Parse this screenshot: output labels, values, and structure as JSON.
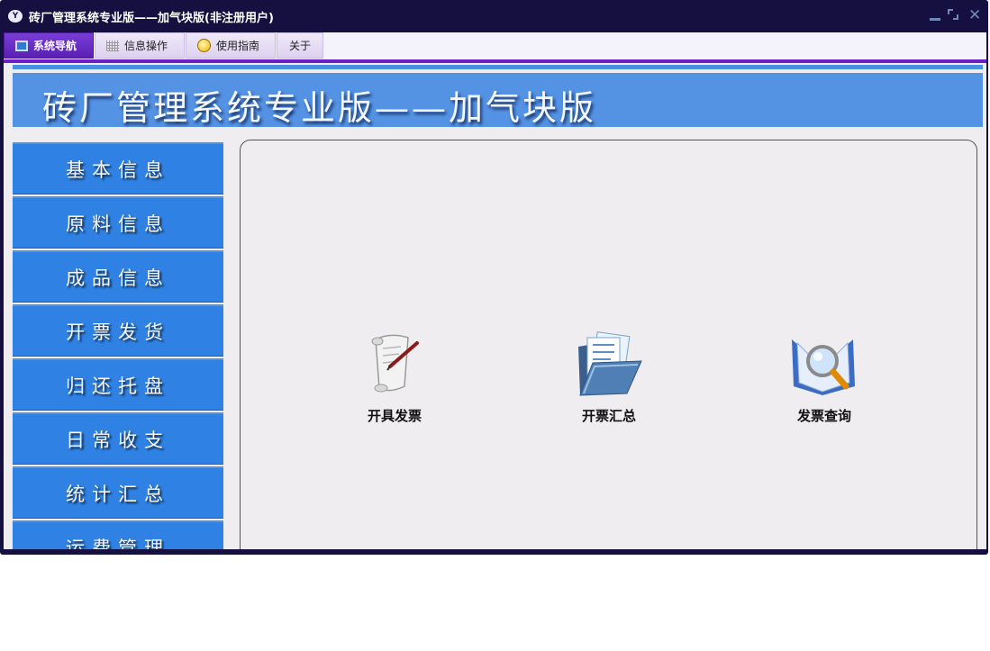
{
  "window": {
    "title": "砖厂管理系统专业版——加气块版(非注册用户)",
    "app_icon_glyph": "Y"
  },
  "menu": {
    "tabs": [
      {
        "label": "系统导航",
        "icon": "monitor-icon",
        "active": true
      },
      {
        "label": "信息操作",
        "icon": "grid-icon",
        "active": false
      },
      {
        "label": "使用指南",
        "icon": "bulb-icon",
        "active": false
      },
      {
        "label": "关于",
        "icon": "",
        "active": false
      }
    ]
  },
  "banner": {
    "title": "砖厂管理系统专业版——加气块版"
  },
  "sidebar": {
    "items": [
      {
        "label": "基本信息"
      },
      {
        "label": "原料信息"
      },
      {
        "label": "成品信息"
      },
      {
        "label": "开票发货"
      },
      {
        "label": "归还托盘"
      },
      {
        "label": "日常收支"
      },
      {
        "label": "统计汇总"
      },
      {
        "label": "运费管理"
      }
    ]
  },
  "main": {
    "functions": [
      {
        "label": "开具发票",
        "icon": "scroll-pen-icon"
      },
      {
        "label": "开票汇总",
        "icon": "folder-documents-icon"
      },
      {
        "label": "发票查询",
        "icon": "book-magnifier-icon"
      }
    ]
  },
  "colors": {
    "title_bar": "#15103f",
    "menu_accent": "#6a1fc9",
    "banner": "#5492e4",
    "nav_button": "#2f82e4"
  }
}
